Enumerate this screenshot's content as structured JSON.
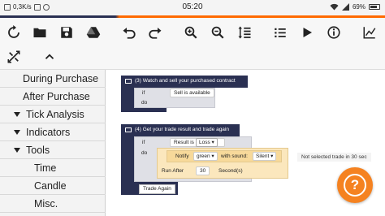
{
  "status_bar": {
    "network_speed": "0,3K/s",
    "time": "05:20",
    "battery": "69%"
  },
  "toolbar": {
    "row1": [
      "refresh-icon",
      "folder-icon",
      "save-icon",
      "google-drive-icon",
      "undo-icon",
      "redo-icon",
      "zoom-in-icon",
      "zoom-out-icon",
      "sort-icon",
      "list-icon",
      "play-icon",
      "info-icon",
      "chart-icon"
    ],
    "row2": [
      "rearrange-icon",
      "collapse-up-icon"
    ]
  },
  "sidebar": {
    "items": [
      {
        "label": "During Purchase",
        "type": "child"
      },
      {
        "label": "After Purchase",
        "type": "child"
      },
      {
        "label": "Tick Analysis",
        "type": "category"
      },
      {
        "label": "Indicators",
        "type": "category"
      },
      {
        "label": "Tools",
        "type": "category"
      },
      {
        "label": "Time",
        "type": "subchild"
      },
      {
        "label": "Candle",
        "type": "subchild"
      },
      {
        "label": "Misc.",
        "type": "subchild"
      }
    ]
  },
  "workspace": {
    "block3": {
      "title": "(3) Watch and sell your purchased contract",
      "if_label": "if",
      "do_label": "do",
      "condition": "Sell is available"
    },
    "block4": {
      "title": "(4) Get your trade result and trade again",
      "if_label": "if",
      "do_label": "do",
      "result_label": "Result is",
      "result_value": "Loss ▾",
      "notify_label": "Notify",
      "notify_color": "green ▾",
      "with_sound_label": "with sound:",
      "sound_value": "Silent ▾",
      "notify_message": "Not selected trade in 30 sec",
      "run_after_label": "Run After",
      "run_after_value": "30",
      "seconds_label": "Second(s)",
      "trade_again_label": "Trade Again"
    }
  },
  "colors": {
    "block_dark": "#2a3052",
    "accent_orange": "#f58220"
  }
}
